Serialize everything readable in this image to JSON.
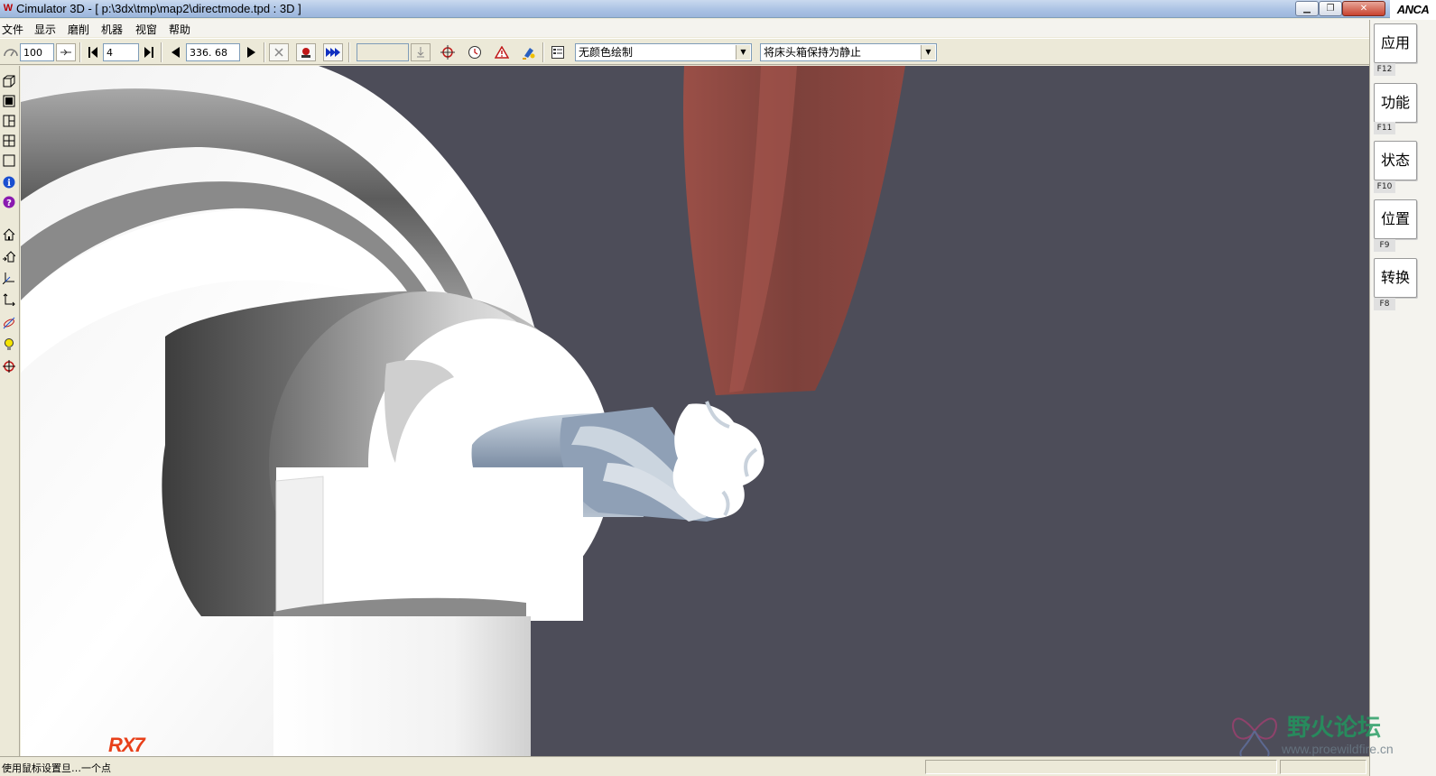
{
  "window": {
    "title": "Cimulator 3D - [ p:\\3dx\\tmp\\map2\\directmode.tpd : 3D ]",
    "app_icon": "W",
    "min_label": "▁",
    "max_label": "❐",
    "close_label": "✕"
  },
  "brand_logo": "ANCA",
  "menu": [
    "文件",
    "显示",
    "磨削",
    "机器",
    "视窗",
    "帮助"
  ],
  "toolbar": {
    "speed_value": "100",
    "step_value": "4",
    "position_value": "336. 68",
    "empty_field_value": "",
    "color_mode": "无颜色绘制",
    "headstock_mode": "将床头箱保持为静止"
  },
  "right_panel": [
    {
      "label": "应用",
      "key": "F12"
    },
    {
      "label": "功能",
      "key": "F11"
    },
    {
      "label": "状态",
      "key": "F10"
    },
    {
      "label": "位置",
      "key": "F9"
    },
    {
      "label": "转换",
      "key": "F8"
    }
  ],
  "viewport": {
    "logo_text": "RX7",
    "background_color": "#4d4d59",
    "wheel_color": "#8b4a44"
  },
  "status": {
    "text": "使用鼠标设置旦…一个点"
  },
  "watermark": {
    "text": "野火论坛",
    "url": "www.proewildfire.cn"
  }
}
